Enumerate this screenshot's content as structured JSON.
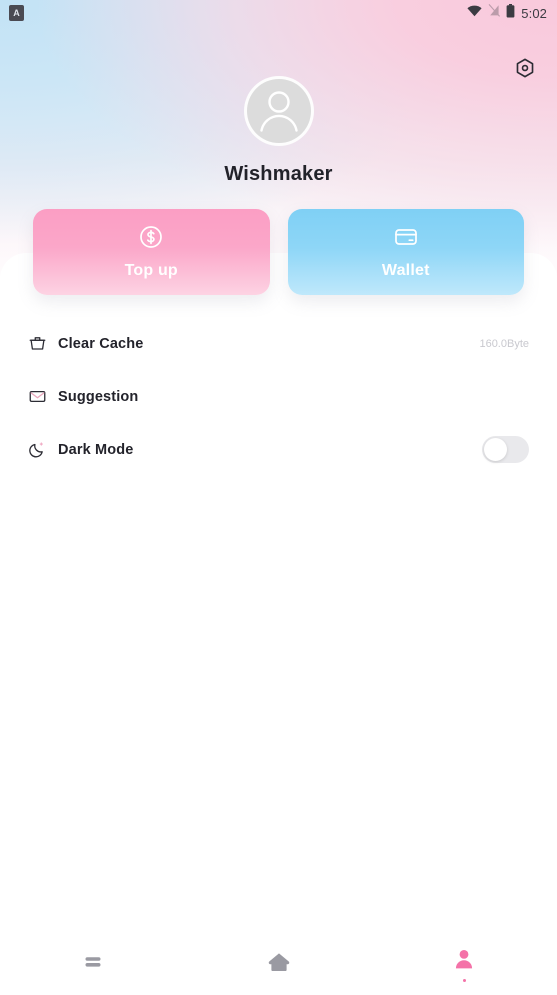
{
  "statusbar": {
    "app_badge": "A",
    "time": "5:02",
    "icons": [
      "wifi-icon",
      "signal-off-icon",
      "battery-icon"
    ]
  },
  "header": {
    "settings_icon": "gear-icon",
    "avatar_icon": "user-avatar-icon",
    "username": "Wishmaker"
  },
  "actions": [
    {
      "label": "Top up",
      "icon": "dollar-circle-icon",
      "color": "#fb9ec4"
    },
    {
      "label": "Wallet",
      "icon": "credit-card-icon",
      "color": "#7fd0f5"
    }
  ],
  "settings_rows": [
    {
      "label": "Clear Cache",
      "icon": "trash-icon",
      "value": "160.0Byte",
      "control": "value"
    },
    {
      "label": "Suggestion",
      "icon": "mail-icon",
      "value": "",
      "control": "none"
    },
    {
      "label": "Dark Mode",
      "icon": "moon-icon",
      "value": "",
      "control": "toggle",
      "toggle_on": false
    }
  ],
  "bottomnav": [
    {
      "icon": "list-icon",
      "active": false
    },
    {
      "icon": "home-icon",
      "active": false
    },
    {
      "icon": "profile-icon",
      "active": true
    }
  ],
  "colors": {
    "accent_pink": "#f472a8",
    "card_pink": "#fb9ec4",
    "card_blue": "#7fd0f5",
    "nav_inactive": "#9a9aa2",
    "text_primary": "#23232b",
    "text_muted": "#c9c9cf"
  }
}
